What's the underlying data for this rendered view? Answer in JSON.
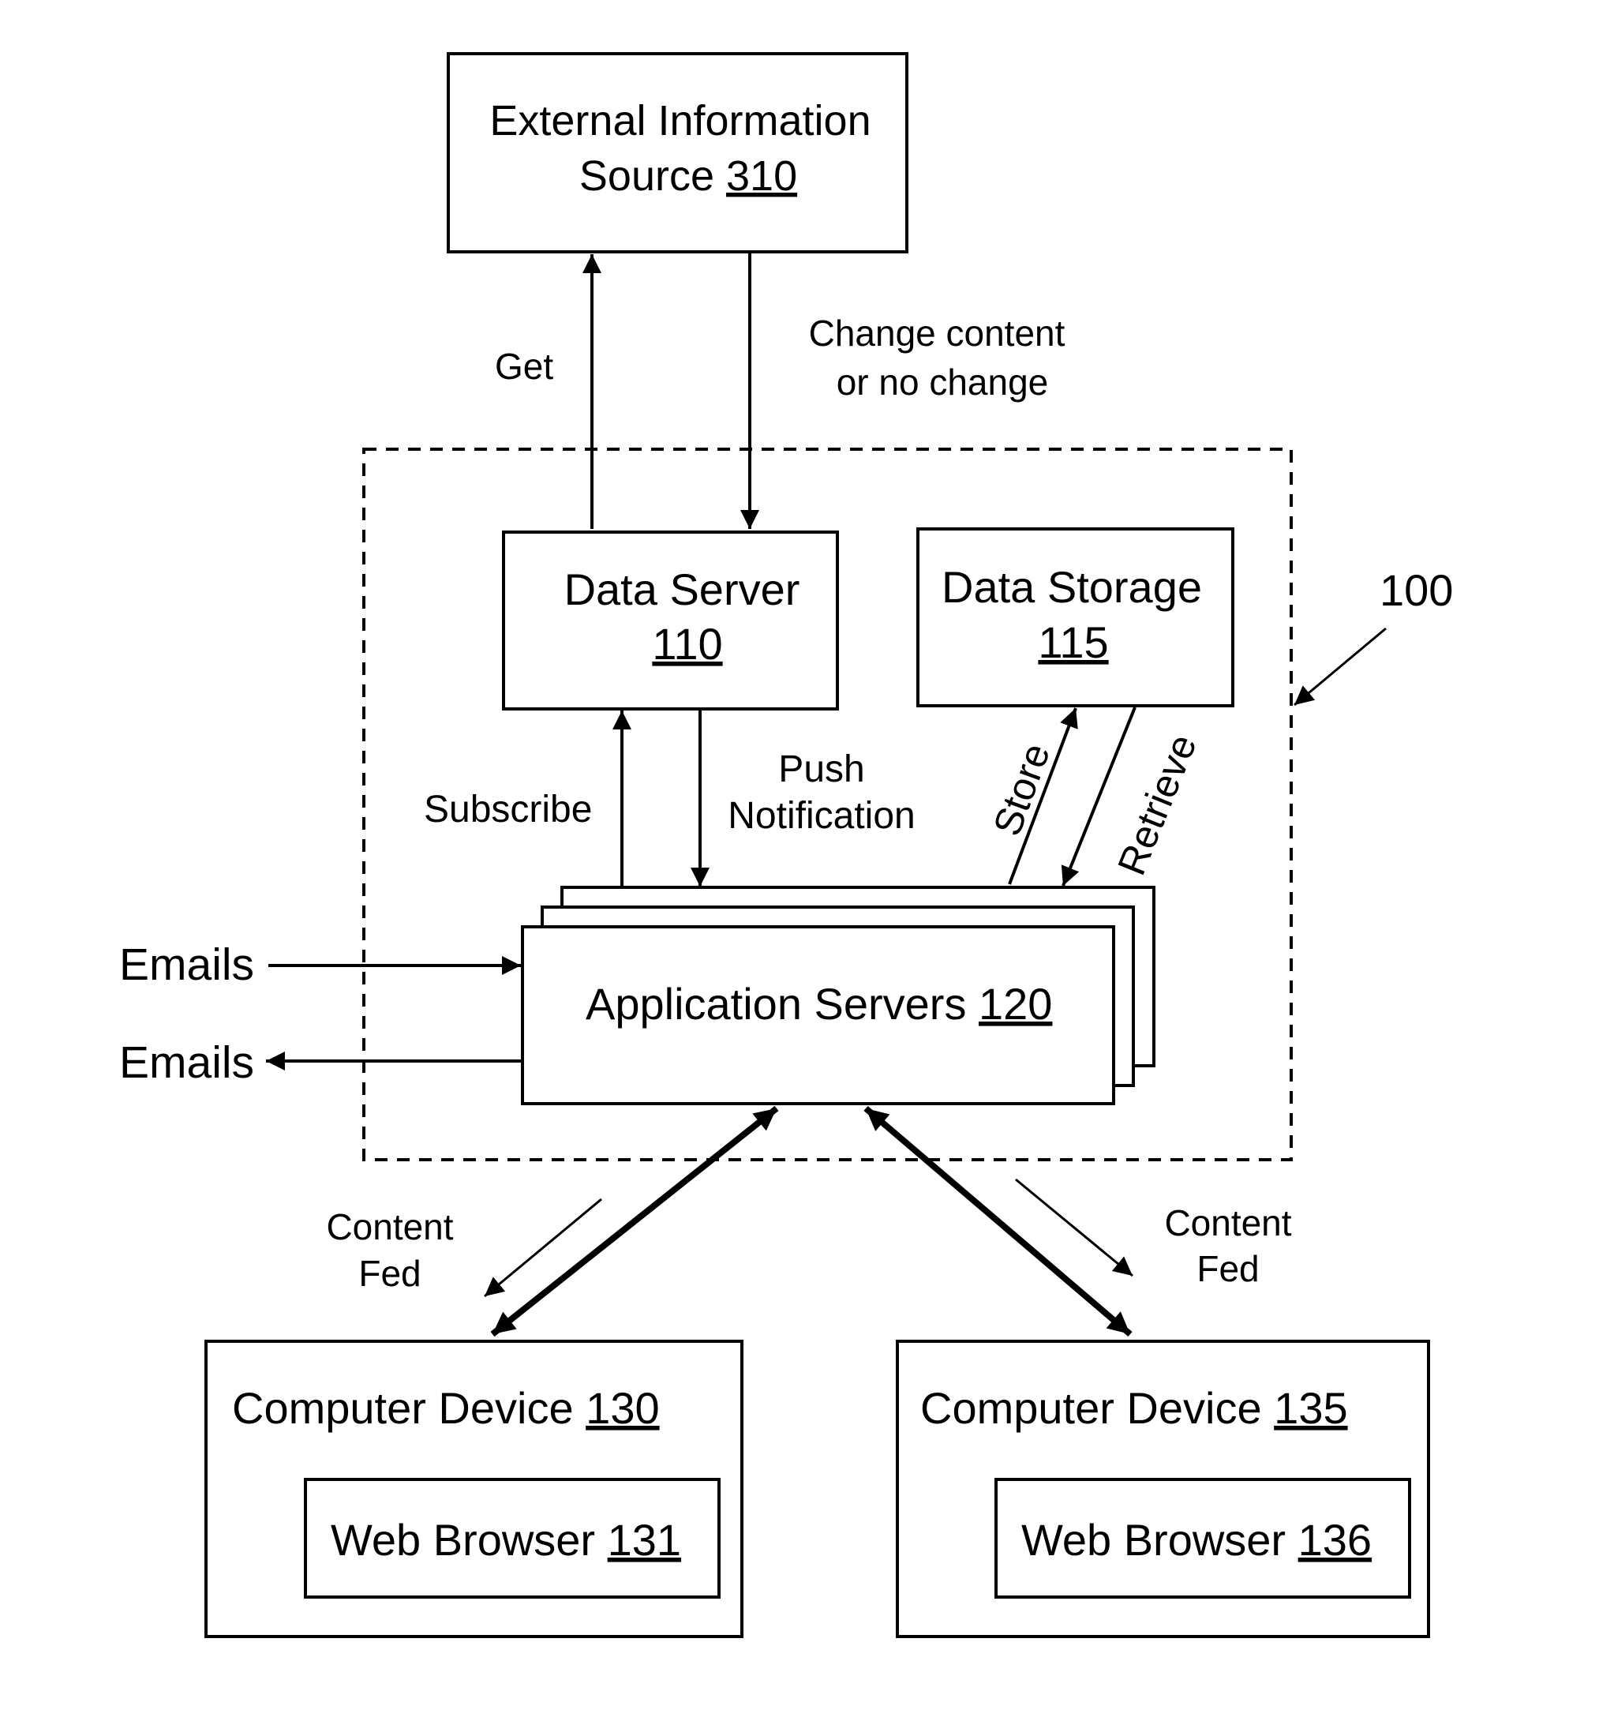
{
  "diagram": {
    "system_ref": "100",
    "external_source": {
      "line1": "External Information",
      "line2_prefix": "Source ",
      "ref": "310"
    },
    "data_server": {
      "label": "Data Server",
      "ref": "110"
    },
    "data_storage": {
      "label": "Data Storage",
      "ref": "115"
    },
    "app_servers": {
      "label": "Application Servers ",
      "ref": "120"
    },
    "device_a": {
      "label": "Computer Device ",
      "ref": "130",
      "browser_label": "Web Browser ",
      "browser_ref": "131"
    },
    "device_b": {
      "label": "Computer Device ",
      "ref": "135",
      "browser_label": "Web Browser ",
      "browser_ref": "136"
    },
    "edges": {
      "get": "Get",
      "change_line1": "Change content",
      "change_line2": "or no change",
      "subscribe": "Subscribe",
      "push_line1": "Push",
      "push_line2": "Notification",
      "store": "Store",
      "retrieve": "Retrieve",
      "emails_in": "Emails",
      "emails_out": "Emails",
      "content_fed_a_line1": "Content",
      "content_fed_a_line2": "Fed",
      "content_fed_b_line1": "Content",
      "content_fed_b_line2": "Fed"
    }
  }
}
